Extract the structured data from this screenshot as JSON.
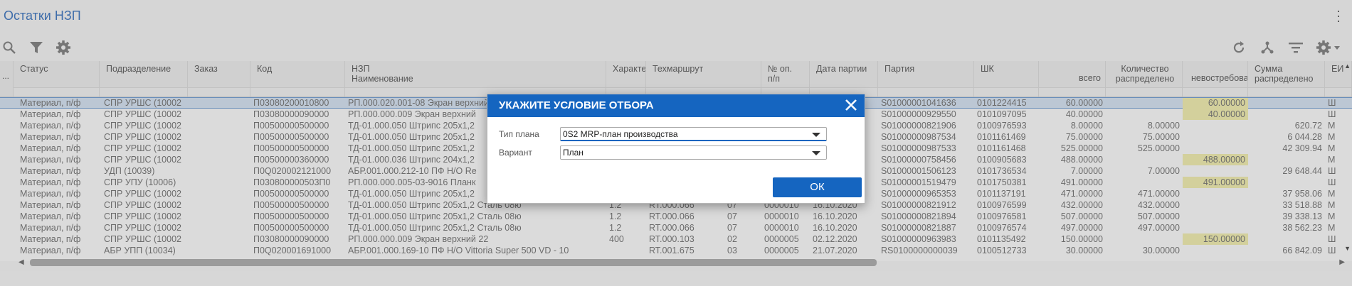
{
  "app": {
    "title": "Остатки НЗП"
  },
  "columns": [
    {
      "label": "Статус"
    },
    {
      "label": "Подразделение"
    },
    {
      "label": "Заказ"
    },
    {
      "label": "Код"
    },
    {
      "label": "НЗП\nНаименование"
    },
    {
      "label": "Характе"
    },
    {
      "label": "Техмаршрут"
    },
    {
      "label": "№ оп.\nп/п"
    },
    {
      "label": "Дата партии"
    },
    {
      "label": "Партия"
    },
    {
      "label": "ШК"
    },
    {
      "label": "всего"
    },
    {
      "label": "Количество\nраспределено"
    },
    {
      "label": "невостребова"
    },
    {
      "label": "Сумма\nраспределено"
    },
    {
      "label": "ЕИ"
    }
  ],
  "rows": [
    [
      "Материал, п/ф",
      "СПР УРШС (10002",
      "",
      "П03080200010800",
      "РП.000.020.001-08 Экран верхний",
      "",
      "",
      "",
      "",
      "S01000001041636",
      "0101224415",
      "60.00000",
      "",
      "60.00000",
      "",
      "Ш"
    ],
    [
      "Материал, п/ф",
      "СПР УРШС (10002",
      "",
      "П03080000090000",
      "РП.000.000.009 Экран верхний",
      "",
      "",
      "",
      "",
      "S01000000929550",
      "0101097095",
      "40.00000",
      "",
      "40.00000",
      "",
      "Ш"
    ],
    [
      "Материал, п/ф",
      "СПР УРШС (10002",
      "",
      "П00500000500000",
      "ТД-01.000.050 Штрипс 205х1,2",
      "",
      "",
      "",
      "",
      "S01000000821906",
      "0100976593",
      "8.00000",
      "8.00000",
      "",
      "620.72",
      "М"
    ],
    [
      "Материал, п/ф",
      "СПР УРШС (10002",
      "",
      "П00500000500000",
      "ТД-01.000.050 Штрипс 205х1,2",
      "",
      "",
      "",
      "",
      "S01000000987534",
      "0101161469",
      "75.00000",
      "75.00000",
      "",
      "6 044.28",
      "М"
    ],
    [
      "Материал, п/ф",
      "СПР УРШС (10002",
      "",
      "П00500000500000",
      "ТД-01.000.050 Штрипс 205х1,2",
      "",
      "",
      "",
      "",
      "S01000000987533",
      "0101161468",
      "525.00000",
      "525.00000",
      "",
      "42 309.94",
      "М"
    ],
    [
      "Материал, п/ф",
      "СПР УРШС (10002",
      "",
      "П00500000360000",
      "ТД-01.000.036 Штрипс 204х1,2",
      "",
      "",
      "",
      "",
      "S01000000758456",
      "0100905683",
      "488.00000",
      "",
      "488.00000",
      "",
      "М"
    ],
    [
      "Материал, п/ф",
      "УДП (10039)",
      "",
      "П0Q020002121000",
      "АБР.001.000.212-10 ПФ Н/О Re",
      "",
      "",
      "",
      "",
      "S01000001506123",
      "0101736534",
      "7.00000",
      "7.00000",
      "",
      "29 648.44",
      "Ш"
    ],
    [
      "Материал, п/ф",
      "СПР УПУ (10006)",
      "",
      "П030800000503П0",
      "РП.000.000.005-03-9016 Планк",
      "",
      "",
      "",
      "",
      "S01000001519479",
      "0101750381",
      "491.00000",
      "",
      "491.00000",
      "",
      "Ш"
    ],
    [
      "Материал, п/ф",
      "СПР УРШС (10002",
      "",
      "П00500000500000",
      "ТД-01.000.050 Штрипс 205х1,2",
      "",
      "",
      "",
      "",
      "S01000000965353",
      "0101137191",
      "471.00000",
      "471.00000",
      "",
      "37 958.06",
      "М"
    ],
    [
      "Материал, п/ф",
      "СПР УРШС (10002",
      "",
      "П00500000500000",
      "ТД-01.000.050 Штрипс 205х1,2 Сталь 08ю",
      "1.2",
      "RT.000.066",
      "07",
      "0000010",
      "S01000000821912",
      "0100976599",
      "432.00000",
      "432.00000",
      "",
      "33 518.88",
      "М"
    ],
    [
      "Материал, п/ф",
      "СПР УРШС (10002",
      "",
      "П00500000500000",
      "ТД-01.000.050 Штрипс 205х1,2 Сталь 08ю",
      "1.2",
      "RT.000.066",
      "07",
      "0000010",
      "S01000000821894",
      "0100976581",
      "507.00000",
      "507.00000",
      "",
      "39 338.13",
      "М"
    ],
    [
      "Материал, п/ф",
      "СПР УРШС (10002",
      "",
      "П00500000500000",
      "ТД-01.000.050 Штрипс 205х1,2 Сталь 08ю",
      "1.2",
      "RT.000.066",
      "07",
      "0000010",
      "S01000000821887",
      "0100976574",
      "497.00000",
      "497.00000",
      "",
      "38 562.23",
      "М"
    ],
    [
      "Материал, п/ф",
      "СПР УРШС (10002",
      "",
      "П03080000090000",
      "РП.000.000.009 Экран верхний 22",
      "400",
      "RT.000.103",
      "02",
      "0000005",
      "S01000000963983",
      "0101135492",
      "150.00000",
      "",
      "150.00000",
      "",
      "Ш"
    ],
    [
      "Материал, п/ф",
      "АБР УПП (10034)",
      "",
      "П0Q020001691000",
      "АБР.001.000.169-10 ПФ Н/О Vittoria Super 500 VD - 10",
      "",
      "RT.001.675",
      "03",
      "0000005",
      "RS0100000000039",
      "0100512733",
      "30.00000",
      "30.00000",
      "",
      "66 842.09",
      "Ш"
    ]
  ],
  "row_dates": [
    "",
    "",
    "",
    "",
    "",
    "",
    "",
    "",
    "",
    "16.10.2020",
    "16.10.2020",
    "16.10.2020",
    "02.12.2020",
    "21.07.2020"
  ],
  "highlight": {
    "color": "#f6f3b6"
  },
  "dialog": {
    "title": "УКАЖИТЕ УСЛОВИЕ ОТБОРА",
    "plan_type_label": "Тип плана",
    "plan_type_value": "0S2 MRP-план производства",
    "variant_label": "Вариант",
    "variant_value": "План",
    "ok_label": "ОК",
    "accent": "#1565c0"
  },
  "icons": [
    "search-icon",
    "filter-icon",
    "settings-icon",
    "refresh-icon",
    "hierarchy-icon",
    "sort-filter-icon",
    "settings-dropdown-icon",
    "more-vert-icon"
  ]
}
